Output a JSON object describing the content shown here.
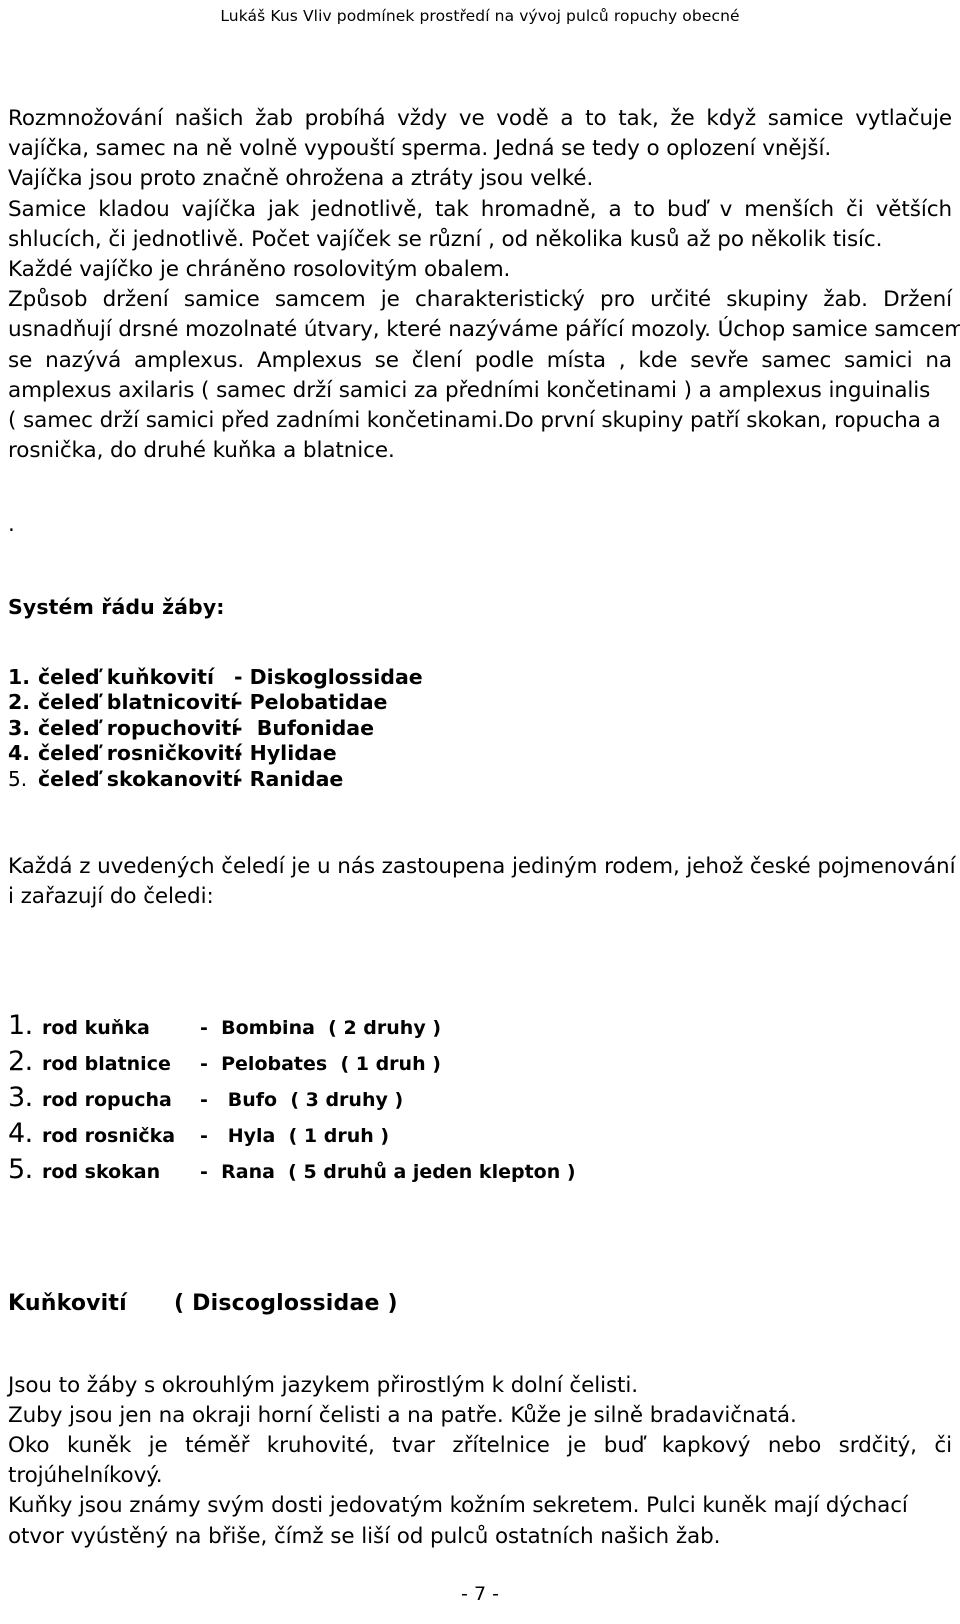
{
  "header": {
    "running_title": "Lukáš Kus  Vliv podmínek prostředí na vývoj  pulců ropuchy obecné"
  },
  "body": {
    "paragraph_1": {
      "lines": [
        "Rozmnožování našich žab probíhá vždy ve vodě a to tak, že když samice   vytlačuje",
        "vajíčka, samec na ně volně vypouští sperma. Jedná se tedy o oplození vnější.",
        "Vajíčka jsou proto značně ohrožena a ztráty jsou velké.",
        "Samice kladou vajíčka jak jednotlivě, tak hromadně, a to buď v menších či větších",
        "shlucích, či jednotlivě. Počet vajíček se různí , od několika kusů až po několik tisíc.",
        "Každé vajíčko je chráněno rosolovitým obalem.",
        "Způsob držení samice samcem je charakteristický pro určité skupiny žab. Držení",
        "usnadňují drsné mozolnaté útvary, které nazýváme pářící mozoly. Úchop samice samcem",
        "se nazývá amplexus. Amplexus se člení podle místa , kde sevře samec samici na",
        "amplexus axilaris ( samec drží samici  za předními končetinami  ) a amplexus inguinalis",
        "( samec drží samici před zadními končetinami.Do první skupiny patří skokan, ropucha a",
        "rosnička, do druhé kuňka a blatnice."
      ]
    },
    "lonely_dot": ".",
    "system_heading": "Systém řádu žáby:",
    "family_list": [
      {
        "num": "1.",
        "czech": "čeleď kuňkovití",
        "dash": "-",
        "latin": "Diskoglossidae",
        "bold_num": true
      },
      {
        "num": "2.",
        "czech": "čeleď blatnicovití",
        "dash": "-",
        "latin": "Pelobatidae",
        "bold_num": true
      },
      {
        "num": "3.",
        "czech": "čeleď ropuchovití",
        "dash": "-",
        "latin": " Bufonidae",
        "bold_num": true
      },
      {
        "num": "4.",
        "czech": "čeleď rosničkovití",
        "dash": "-",
        "latin": "Hylidae",
        "bold_num": true
      },
      {
        "num": "5.",
        "czech": "čeleď skokanovití",
        "dash": "-",
        "latin": "Ranidae",
        "bold_num": false
      }
    ],
    "paragraph_2": {
      "lines": [
        "Každá z uvedených čeledí je u nás zastoupena jediným rodem, jehož české pojmenování vymezuje",
        "i zařazují do čeledi:"
      ]
    },
    "genus_list": [
      {
        "num": "1.",
        "czech": "rod kuňka",
        "dash": "-",
        "latin": "Bombina",
        "count": "( 2 druhy )"
      },
      {
        "num": "2.",
        "czech": "rod blatnice",
        "dash": "-",
        "latin": "Pelobates",
        "count": "( 1 druh )"
      },
      {
        "num": "3.",
        "czech": "rod ropucha",
        "dash": "-",
        "latin": " Bufo",
        "count": "( 3 druhy )"
      },
      {
        "num": "4.",
        "czech": "rod rosnička",
        "dash": "-",
        "latin": " Hyla",
        "count": "( 1 druh )"
      },
      {
        "num": "5.",
        "czech": "rod skokan",
        "dash": "-",
        "latin": "Rana",
        "count": "( 5 druhů a jeden klepton )"
      }
    ],
    "taxon_heading": "Kuňkovití      ( Discoglossidae )",
    "paragraph_3": {
      "lines": [
        "Jsou to žáby s okrouhlým jazykem přirostlým k dolní čelisti.",
        "Zuby jsou jen na okraji horní čelisti a na patře. Kůže je silně bradavičnatá.",
        "Oko kuněk je téměř kruhovité, tvar zřítelnice je buď kapkový nebo srdčitý, či",
        "trojúhelníkový.",
        "Kuňky jsou známy svým dosti jedovatým kožním sekretem. Pulci kuněk mají dýchací",
        "otvor vyústěný na břiše, čímž se liší od pulců ostatních našich žab."
      ]
    }
  },
  "footer": {
    "page_number": "- 7 -"
  }
}
